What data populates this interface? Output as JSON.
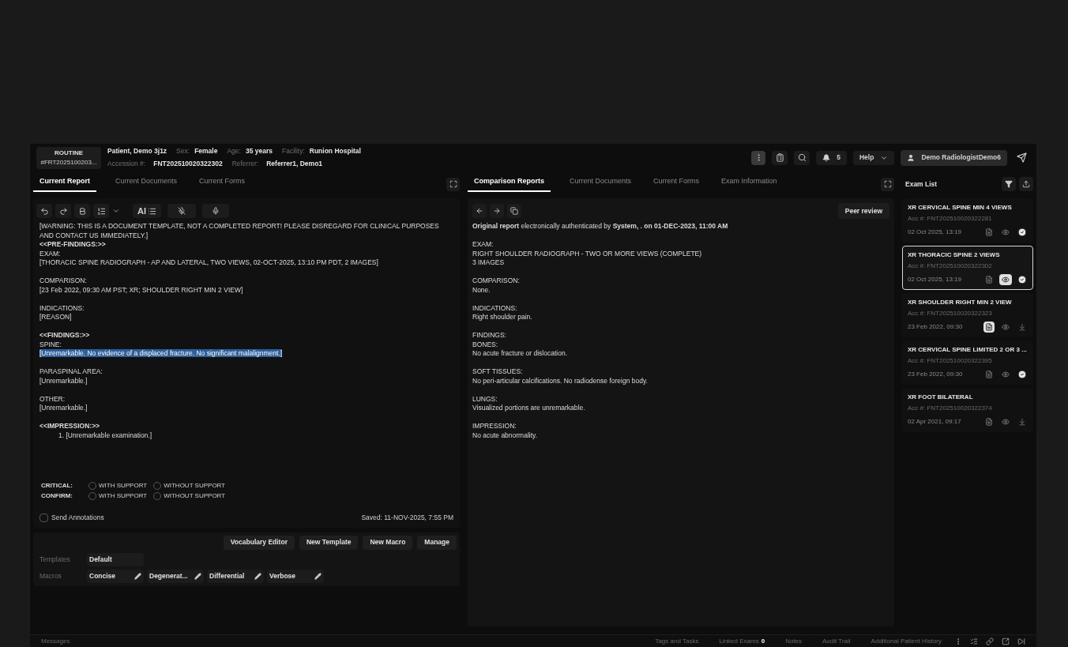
{
  "header": {
    "priority": "ROUTINE",
    "order_id": "#FRT2025100203...",
    "patient": "Patient, Demo 3j1z",
    "fields_row1": [
      {
        "label": "Sex:",
        "value": "Female"
      },
      {
        "label": "Age:",
        "value": "35 years"
      },
      {
        "label": "Facility:",
        "value": "Runion Hospital"
      }
    ],
    "fields_row2": [
      {
        "label": "Accession #:",
        "value": "FNT202510020322302"
      },
      {
        "label": "Referrer:",
        "value": "Referrer1, Demo1"
      }
    ],
    "notifications": "5",
    "help": "Help",
    "user": "Demo RadiologistDemo6"
  },
  "toolbar": {
    "ai_label": "AI"
  },
  "left_tabs": [
    {
      "label": "Current Report",
      "selected": true
    },
    {
      "label": "Current Documents",
      "selected": false
    },
    {
      "label": "Current Forms",
      "selected": false
    }
  ],
  "report_lines": [
    {
      "kind": "text",
      "text": "[WARNING: THIS IS A DOCUMENT TEMPLATE, NOT A COMPLETED REPORT! PLEASE DISREGARD FOR CLINICAL PURPOSES AND CONTACT US IMMEDIATELY.]"
    },
    {
      "kind": "bold",
      "text": "<<PRE-FINDINGS:>>"
    },
    {
      "kind": "text",
      "text": "EXAM:"
    },
    {
      "kind": "text",
      "text": "[THORACIC SPINE RADIOGRAPH - AP AND LATERAL, TWO VIEWS, 02-OCT-2025, 13:10 PM PDT, 2 IMAGES]"
    },
    {
      "kind": "gap"
    },
    {
      "kind": "text",
      "text": "COMPARISON:"
    },
    {
      "kind": "text",
      "text": "[23 Feb 2022, 09:30 AM PST; XR; SHOULDER RIGHT MIN 2 VIEW]"
    },
    {
      "kind": "gap"
    },
    {
      "kind": "text",
      "text": "INDICATIONS:"
    },
    {
      "kind": "text",
      "text": "[REASON]"
    },
    {
      "kind": "gap"
    },
    {
      "kind": "bold",
      "text": "<<FINDINGS:>>"
    },
    {
      "kind": "text",
      "text": "SPINE:"
    },
    {
      "kind": "selected",
      "text": "[Unremarkable. No evidence of a displaced fracture. No significant malalignment.]"
    },
    {
      "kind": "gap"
    },
    {
      "kind": "text",
      "text": "PARASPINAL AREA:"
    },
    {
      "kind": "text",
      "text": "[Unremarkable.]"
    },
    {
      "kind": "gap"
    },
    {
      "kind": "text",
      "text": "OTHER:"
    },
    {
      "kind": "text",
      "text": "[Unremarkable.]"
    },
    {
      "kind": "gap"
    },
    {
      "kind": "bold",
      "text": "<<IMPRESSION:>>"
    },
    {
      "kind": "indent",
      "text": "1. [Unremarkable examination.]"
    }
  ],
  "radio_groups": [
    {
      "label": "CRITICAL:",
      "options": [
        {
          "label": "WITH SUPPORT",
          "selected": false
        },
        {
          "label": "WITHOUT SUPPORT",
          "selected": false
        }
      ]
    },
    {
      "label": "CONFIRM:",
      "options": [
        {
          "label": "WITH SUPPORT",
          "selected": false
        },
        {
          "label": "WITHOUT SUPPORT",
          "selected": false
        }
      ]
    }
  ],
  "send_annotations": {
    "label": "Send Annotations",
    "checked": false
  },
  "saved": "Saved: 11-NOV-2025, 7:55 PM",
  "action_buttons": [
    "Vocabulary Editor",
    "New Template",
    "New Macro",
    "Manage"
  ],
  "templates": {
    "label": "Templates",
    "items": [
      "Default"
    ]
  },
  "macros": {
    "label": "Macros",
    "items": [
      "Concise",
      "Degenerat...",
      "Differential",
      "Verbose"
    ]
  },
  "middle_tabs": [
    {
      "label": "Comparison Reports",
      "selected": true
    },
    {
      "label": "Current Documents",
      "selected": false
    },
    {
      "label": "Current Forms",
      "selected": false
    },
    {
      "label": "Exam Information",
      "selected": false
    }
  ],
  "peer_review": "Peer review",
  "comparison_lines": [
    {
      "kind": "text",
      "text": "**Original report** electronically authenticated by **System, . on 01-DEC-2023, 11:00 AM**"
    },
    {
      "kind": "gap"
    },
    {
      "kind": "text",
      "text": "EXAM:"
    },
    {
      "kind": "text",
      "text": "RIGHT SHOULDER RADIOGRAPH - TWO OR MORE VIEWS (COMPLETE)"
    },
    {
      "kind": "text",
      "text": "3 IMAGES"
    },
    {
      "kind": "gap"
    },
    {
      "kind": "text",
      "text": "COMPARISON:"
    },
    {
      "kind": "text",
      "text": "None."
    },
    {
      "kind": "gap"
    },
    {
      "kind": "text",
      "text": "INDICATIONS:"
    },
    {
      "kind": "text",
      "text": "Right shoulder pain."
    },
    {
      "kind": "gap"
    },
    {
      "kind": "text",
      "text": "FINDINGS:"
    },
    {
      "kind": "text",
      "text": "BONES:"
    },
    {
      "kind": "text",
      "text": "No acute fracture or dislocation."
    },
    {
      "kind": "gap"
    },
    {
      "kind": "text",
      "text": "SOFT TISSUES:"
    },
    {
      "kind": "text",
      "text": "No peri-articular calcifications. No radiodense foreign body."
    },
    {
      "kind": "gap"
    },
    {
      "kind": "text",
      "text": "LUNGS:"
    },
    {
      "kind": "text",
      "text": "Visualized portions are unremarkable."
    },
    {
      "kind": "gap"
    },
    {
      "kind": "text",
      "text": "IMPRESSION:"
    },
    {
      "kind": "text",
      "text": "No acute abnormality."
    }
  ],
  "exam_list": {
    "title": "Exam List",
    "items": [
      {
        "title": "XR CERVICAL SPINE MIN 4 VIEWS",
        "accession": "Acc #: FNT202510020322281",
        "date": "02 Oct 2025, 13:19",
        "selected": false,
        "viewing": false,
        "report_open": false,
        "signed": true
      },
      {
        "title": "XR THORACIC SPINE 2 VIEWS",
        "accession": "Acc #: FNT202510020322302",
        "date": "02 Oct 2025, 13:19",
        "selected": true,
        "viewing": true,
        "report_open": false,
        "signed": true
      },
      {
        "title": "XR SHOULDER RIGHT MIN 2 VIEW",
        "accession": "Acc #: FNT202510020322323",
        "date": "23 Feb 2022, 09:30",
        "selected": false,
        "viewing": false,
        "report_open": true,
        "signed": false
      },
      {
        "title": "XR CERVICAL SPINE LIMITED 2 OR 3 ...",
        "accession": "Acc #: FNT202510020322395",
        "date": "23 Feb 2022, 09:30",
        "selected": false,
        "viewing": false,
        "report_open": false,
        "signed": true
      },
      {
        "title": "XR FOOT BILATERAL",
        "accession": "Acc #: FNT202510020322374",
        "date": "02 Apr 2021, 09:17",
        "selected": false,
        "viewing": false,
        "report_open": false,
        "signed": false
      }
    ]
  },
  "footer": {
    "messages": "Messages",
    "links": [
      "Tags and Tasks",
      "Linked Exams",
      "Notes",
      "Audit Trail",
      "Additional Patient History"
    ],
    "linked_count": "0"
  }
}
